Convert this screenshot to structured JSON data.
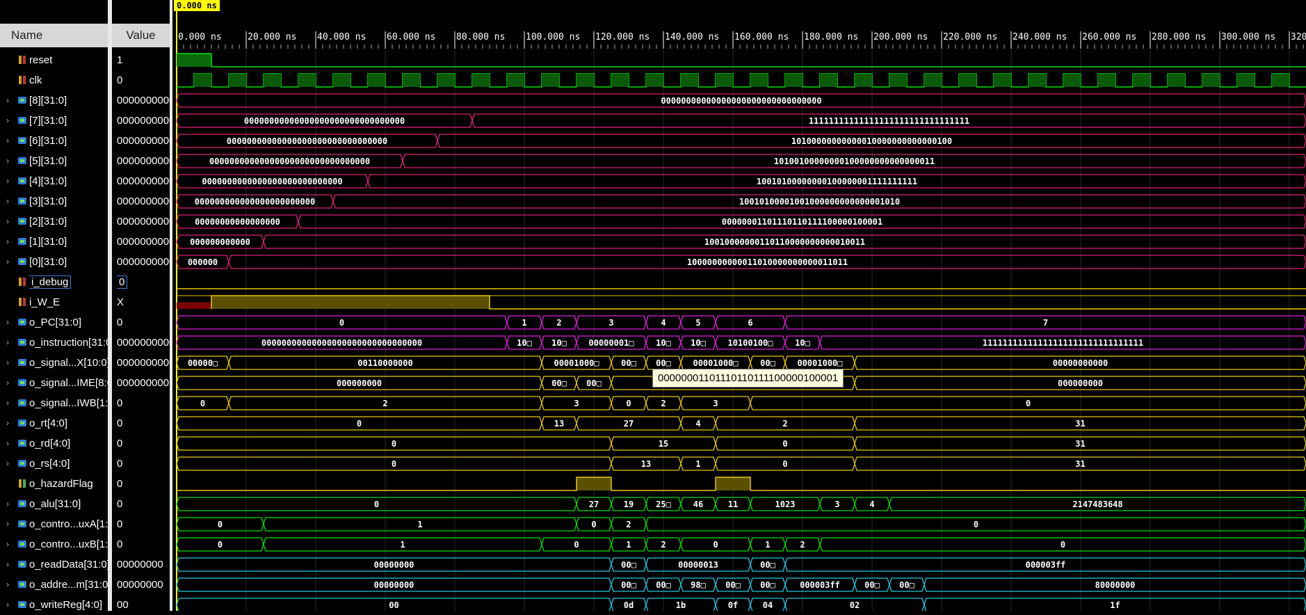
{
  "header": {
    "name_label": "Name",
    "value_label": "Value"
  },
  "cursor": {
    "time_label": "0.000 ns"
  },
  "timeline": {
    "ticks": [
      "0.000 ns",
      "20.000 ns",
      "40.000 ns",
      "60.000 ns",
      "80.000 ns",
      "100.000 ns",
      "120.000 ns",
      "140.000 ns",
      "160.000 ns",
      "180.000 ns",
      "200.000 ns",
      "220.000 ns",
      "240.000 ns",
      "260.000 ns",
      "280.000 ns",
      "300.000 ns",
      "320"
    ]
  },
  "tooltip": {
    "text": "00000001101110110111100000100001"
  },
  "colors": {
    "green": "#00e000",
    "pink": "#e0207a",
    "yellow": "#e8c800",
    "cyan": "#20c8e0",
    "magenta": "#e020e0",
    "red": "#c00000"
  },
  "signals": [
    {
      "name": "reset",
      "value": "1",
      "kind": "bit",
      "expand": false,
      "icon": "input-port-icon"
    },
    {
      "name": "clk",
      "value": "0",
      "kind": "bit",
      "expand": false,
      "icon": "input-port-icon"
    },
    {
      "name": "[8][31:0]",
      "value": "0000000000",
      "kind": "bus",
      "expand": true,
      "icon": "bus-icon"
    },
    {
      "name": "[7][31:0]",
      "value": "0000000000",
      "kind": "bus",
      "expand": true,
      "icon": "bus-icon"
    },
    {
      "name": "[6][31:0]",
      "value": "0000000000",
      "kind": "bus",
      "expand": true,
      "icon": "bus-icon"
    },
    {
      "name": "[5][31:0]",
      "value": "0000000000",
      "kind": "bus",
      "expand": true,
      "icon": "bus-icon"
    },
    {
      "name": "[4][31:0]",
      "value": "0000000000",
      "kind": "bus",
      "expand": true,
      "icon": "bus-icon"
    },
    {
      "name": "[3][31:0]",
      "value": "0000000000",
      "kind": "bus",
      "expand": true,
      "icon": "bus-icon"
    },
    {
      "name": "[2][31:0]",
      "value": "0000000000",
      "kind": "bus",
      "expand": true,
      "icon": "bus-icon"
    },
    {
      "name": "[1][31:0]",
      "value": "0000000000",
      "kind": "bus",
      "expand": true,
      "icon": "bus-icon"
    },
    {
      "name": "[0][31:0]",
      "value": "0000000000",
      "kind": "bus",
      "expand": true,
      "icon": "bus-icon"
    },
    {
      "name": "i_debug",
      "value": "0",
      "kind": "bit",
      "expand": false,
      "icon": "input-port-icon",
      "selected": true
    },
    {
      "name": "i_W_E",
      "value": "X",
      "kind": "bit",
      "expand": false,
      "icon": "input-port-icon"
    },
    {
      "name": "o_PC[31:0]",
      "value": "0",
      "kind": "bus",
      "expand": true,
      "icon": "bus-icon"
    },
    {
      "name": "o_instruction[31:0",
      "value": "0000000000",
      "kind": "bus",
      "expand": true,
      "icon": "bus-icon"
    },
    {
      "name": "o_signal...X[10:0]",
      "value": "0000000000",
      "kind": "bus",
      "expand": true,
      "icon": "bus-icon"
    },
    {
      "name": "o_signal...IME[8:0",
      "value": "000000000",
      "kind": "bus",
      "expand": true,
      "icon": "bus-icon"
    },
    {
      "name": "o_signal...IWB[1:0",
      "value": "0",
      "kind": "bus",
      "expand": true,
      "icon": "bus-icon"
    },
    {
      "name": "o_rt[4:0]",
      "value": "0",
      "kind": "bus",
      "expand": true,
      "icon": "bus-icon"
    },
    {
      "name": "o_rd[4:0]",
      "value": "0",
      "kind": "bus",
      "expand": true,
      "icon": "bus-icon"
    },
    {
      "name": "o_rs[4:0]",
      "value": "0",
      "kind": "bus",
      "expand": true,
      "icon": "bus-icon"
    },
    {
      "name": "o_hazardFlag",
      "value": "0",
      "kind": "bit",
      "expand": false,
      "icon": "output-port-icon"
    },
    {
      "name": "o_alu[31:0]",
      "value": "0",
      "kind": "bus",
      "expand": true,
      "icon": "bus-icon"
    },
    {
      "name": "o_contro...uxA[1:0",
      "value": "0",
      "kind": "bus",
      "expand": true,
      "icon": "bus-icon"
    },
    {
      "name": "o_contro...uxB[1:0",
      "value": "0",
      "kind": "bus",
      "expand": true,
      "icon": "bus-icon"
    },
    {
      "name": "o_readData[31:0]",
      "value": "00000000",
      "kind": "bus",
      "expand": true,
      "icon": "bus-icon"
    },
    {
      "name": "o_addre...m[31:0]",
      "value": "00000000",
      "kind": "bus",
      "expand": true,
      "icon": "bus-icon"
    },
    {
      "name": "o_writeReg[4:0]",
      "value": "00",
      "kind": "bus",
      "expand": true,
      "icon": "bus-icon"
    }
  ],
  "waves": [
    {
      "type": "reset",
      "color": "green"
    },
    {
      "type": "clock",
      "color": "green"
    },
    {
      "type": "bus",
      "color": "pink",
      "segs": [
        {
          "s": 0,
          "e": 330,
          "v": "00000000000000000000000000000000"
        }
      ]
    },
    {
      "type": "bus",
      "color": "pink",
      "segs": [
        {
          "s": 0,
          "e": 85,
          "v": "00000000000000000000000000000000"
        },
        {
          "s": 85,
          "e": 330,
          "v": "11111111111111111111111111111111"
        }
      ]
    },
    {
      "type": "bus",
      "color": "pink",
      "segs": [
        {
          "s": 0,
          "e": 75,
          "v": "00000000000000000000000000000000"
        },
        {
          "s": 75,
          "e": 330,
          "v": "10100000000000010000000000000100"
        }
      ]
    },
    {
      "type": "bus",
      "color": "pink",
      "segs": [
        {
          "s": 0,
          "e": 65,
          "v": "00000000000000000000000000000000"
        },
        {
          "s": 65,
          "e": 330,
          "v": "10100100000000100000000000000011"
        }
      ]
    },
    {
      "type": "bus",
      "color": "pink",
      "segs": [
        {
          "s": 0,
          "e": 55,
          "v": "0000000000000000000000000000"
        },
        {
          "s": 55,
          "e": 330,
          "v": "10010100000000100000001111111111"
        }
      ]
    },
    {
      "type": "bus",
      "color": "pink",
      "segs": [
        {
          "s": 0,
          "e": 45,
          "v": "000000000000000000000000"
        },
        {
          "s": 45,
          "e": 330,
          "v": "10010100001001000000000000001010"
        }
      ]
    },
    {
      "type": "bus",
      "color": "pink",
      "segs": [
        {
          "s": 0,
          "e": 35,
          "v": "00000000000000000"
        },
        {
          "s": 35,
          "e": 330,
          "v": "00000001101110110111100000100001"
        }
      ]
    },
    {
      "type": "bus",
      "color": "pink",
      "segs": [
        {
          "s": 0,
          "e": 25,
          "v": "000000000000"
        },
        {
          "s": 25,
          "e": 330,
          "v": "10010000000110110000000000010011"
        }
      ]
    },
    {
      "type": "bus",
      "color": "pink",
      "segs": [
        {
          "s": 0,
          "e": 15,
          "v": "000000"
        },
        {
          "s": 15,
          "e": 330,
          "v": "10000000000011010000000000011011"
        }
      ]
    },
    {
      "type": "low",
      "color": "yellow"
    },
    {
      "type": "we",
      "color": "yellow"
    },
    {
      "type": "bus",
      "color": "magenta",
      "segs": [
        {
          "s": 0,
          "e": 95,
          "v": "0"
        },
        {
          "s": 95,
          "e": 105,
          "v": "1"
        },
        {
          "s": 105,
          "e": 115,
          "v": "2"
        },
        {
          "s": 115,
          "e": 135,
          "v": "3"
        },
        {
          "s": 135,
          "e": 145,
          "v": "4"
        },
        {
          "s": 145,
          "e": 155,
          "v": "5"
        },
        {
          "s": 155,
          "e": 175,
          "v": "6"
        },
        {
          "s": 175,
          "e": 330,
          "v": "7"
        }
      ]
    },
    {
      "type": "bus",
      "color": "magenta",
      "segs": [
        {
          "s": 0,
          "e": 95,
          "v": "00000000000000000000000000000000"
        },
        {
          "s": 95,
          "e": 105,
          "v": "10□"
        },
        {
          "s": 105,
          "e": 115,
          "v": "10□"
        },
        {
          "s": 115,
          "e": 135,
          "v": "00000001□"
        },
        {
          "s": 135,
          "e": 145,
          "v": "10□"
        },
        {
          "s": 145,
          "e": 155,
          "v": "10□"
        },
        {
          "s": 155,
          "e": 175,
          "v": "10100100□"
        },
        {
          "s": 175,
          "e": 185,
          "v": "10□"
        },
        {
          "s": 185,
          "e": 330,
          "v": "11111111111111111111111111111111"
        }
      ]
    },
    {
      "type": "bus",
      "color": "yellow",
      "segs": [
        {
          "s": 0,
          "e": 15,
          "v": "00000□"
        },
        {
          "s": 15,
          "e": 105,
          "v": "00110000000"
        },
        {
          "s": 105,
          "e": 125,
          "v": "00001000□"
        },
        {
          "s": 125,
          "e": 135,
          "v": "00□"
        },
        {
          "s": 135,
          "e": 145,
          "v": "00□"
        },
        {
          "s": 145,
          "e": 165,
          "v": "00001000□"
        },
        {
          "s": 165,
          "e": 175,
          "v": "00□"
        },
        {
          "s": 175,
          "e": 195,
          "v": "00001000□"
        },
        {
          "s": 195,
          "e": 330,
          "v": "00000000000"
        }
      ]
    },
    {
      "type": "bus",
      "color": "yellow",
      "segs": [
        {
          "s": 0,
          "e": 105,
          "v": "000000000"
        },
        {
          "s": 105,
          "e": 115,
          "v": "00□"
        },
        {
          "s": 115,
          "e": 125,
          "v": "00□"
        },
        {
          "s": 125,
          "e": 195,
          "v": "000000"
        },
        {
          "s": 195,
          "e": 330,
          "v": "000000000"
        }
      ]
    },
    {
      "type": "bus",
      "color": "yellow",
      "segs": [
        {
          "s": 0,
          "e": 15,
          "v": "0"
        },
        {
          "s": 15,
          "e": 105,
          "v": "2"
        },
        {
          "s": 105,
          "e": 125,
          "v": "3"
        },
        {
          "s": 125,
          "e": 135,
          "v": "0"
        },
        {
          "s": 135,
          "e": 145,
          "v": "2"
        },
        {
          "s": 145,
          "e": 165,
          "v": "3"
        },
        {
          "s": 165,
          "e": 330,
          "v": "0"
        }
      ]
    },
    {
      "type": "bus",
      "color": "yellow",
      "segs": [
        {
          "s": 0,
          "e": 105,
          "v": "0"
        },
        {
          "s": 105,
          "e": 115,
          "v": "13"
        },
        {
          "s": 115,
          "e": 145,
          "v": "27"
        },
        {
          "s": 145,
          "e": 155,
          "v": "4"
        },
        {
          "s": 155,
          "e": 195,
          "v": "2"
        },
        {
          "s": 195,
          "e": 330,
          "v": "31"
        }
      ]
    },
    {
      "type": "bus",
      "color": "yellow",
      "segs": [
        {
          "s": 0,
          "e": 125,
          "v": "0"
        },
        {
          "s": 125,
          "e": 155,
          "v": "15"
        },
        {
          "s": 155,
          "e": 195,
          "v": "0"
        },
        {
          "s": 195,
          "e": 330,
          "v": "31"
        }
      ]
    },
    {
      "type": "bus",
      "color": "yellow",
      "segs": [
        {
          "s": 0,
          "e": 125,
          "v": "0"
        },
        {
          "s": 125,
          "e": 145,
          "v": "13"
        },
        {
          "s": 145,
          "e": 155,
          "v": "1"
        },
        {
          "s": 155,
          "e": 195,
          "v": "0"
        },
        {
          "s": 195,
          "e": 330,
          "v": "31"
        }
      ]
    },
    {
      "type": "hazard",
      "color": "yellow"
    },
    {
      "type": "bus",
      "color": "green",
      "segs": [
        {
          "s": 0,
          "e": 115,
          "v": "0"
        },
        {
          "s": 115,
          "e": 125,
          "v": "27"
        },
        {
          "s": 125,
          "e": 135,
          "v": "19"
        },
        {
          "s": 135,
          "e": 145,
          "v": "25□"
        },
        {
          "s": 145,
          "e": 155,
          "v": "46"
        },
        {
          "s": 155,
          "e": 165,
          "v": "11"
        },
        {
          "s": 165,
          "e": 185,
          "v": "1023"
        },
        {
          "s": 185,
          "e": 195,
          "v": "3"
        },
        {
          "s": 195,
          "e": 205,
          "v": "4"
        },
        {
          "s": 205,
          "e": 330,
          "v": "2147483648"
        }
      ]
    },
    {
      "type": "bus",
      "color": "green",
      "segs": [
        {
          "s": 0,
          "e": 25,
          "v": "0"
        },
        {
          "s": 25,
          "e": 115,
          "v": "1"
        },
        {
          "s": 115,
          "e": 125,
          "v": "0"
        },
        {
          "s": 125,
          "e": 135,
          "v": "2"
        },
        {
          "s": 135,
          "e": 330,
          "v": "0"
        }
      ]
    },
    {
      "type": "bus",
      "color": "green",
      "segs": [
        {
          "s": 0,
          "e": 25,
          "v": "0"
        },
        {
          "s": 25,
          "e": 105,
          "v": "1"
        },
        {
          "s": 105,
          "e": 125,
          "v": "0"
        },
        {
          "s": 125,
          "e": 135,
          "v": "1"
        },
        {
          "s": 135,
          "e": 145,
          "v": "2"
        },
        {
          "s": 145,
          "e": 165,
          "v": "0"
        },
        {
          "s": 165,
          "e": 175,
          "v": "1"
        },
        {
          "s": 175,
          "e": 185,
          "v": "2"
        },
        {
          "s": 185,
          "e": 330,
          "v": "0"
        }
      ]
    },
    {
      "type": "bus",
      "color": "cyan",
      "segs": [
        {
          "s": 0,
          "e": 125,
          "v": "00000000"
        },
        {
          "s": 125,
          "e": 135,
          "v": "00□"
        },
        {
          "s": 135,
          "e": 165,
          "v": "00000013"
        },
        {
          "s": 165,
          "e": 175,
          "v": "00□"
        },
        {
          "s": 175,
          "e": 330,
          "v": "000003ff"
        }
      ]
    },
    {
      "type": "bus",
      "color": "cyan",
      "segs": [
        {
          "s": 0,
          "e": 125,
          "v": "00000000"
        },
        {
          "s": 125,
          "e": 135,
          "v": "00□"
        },
        {
          "s": 135,
          "e": 145,
          "v": "00□"
        },
        {
          "s": 145,
          "e": 155,
          "v": "98□"
        },
        {
          "s": 155,
          "e": 165,
          "v": "00□"
        },
        {
          "s": 165,
          "e": 175,
          "v": "00□"
        },
        {
          "s": 175,
          "e": 195,
          "v": "000003ff"
        },
        {
          "s": 195,
          "e": 205,
          "v": "00□"
        },
        {
          "s": 205,
          "e": 215,
          "v": "00□"
        },
        {
          "s": 215,
          "e": 330,
          "v": "80000000"
        }
      ]
    },
    {
      "type": "bus",
      "color": "cyan",
      "segs": [
        {
          "s": 0,
          "e": 125,
          "v": "00"
        },
        {
          "s": 125,
          "e": 135,
          "v": "0d"
        },
        {
          "s": 135,
          "e": 155,
          "v": "1b"
        },
        {
          "s": 155,
          "e": 165,
          "v": "0f"
        },
        {
          "s": 165,
          "e": 175,
          "v": "04"
        },
        {
          "s": 175,
          "e": 215,
          "v": "02"
        },
        {
          "s": 215,
          "e": 330,
          "v": "1f"
        }
      ]
    }
  ]
}
